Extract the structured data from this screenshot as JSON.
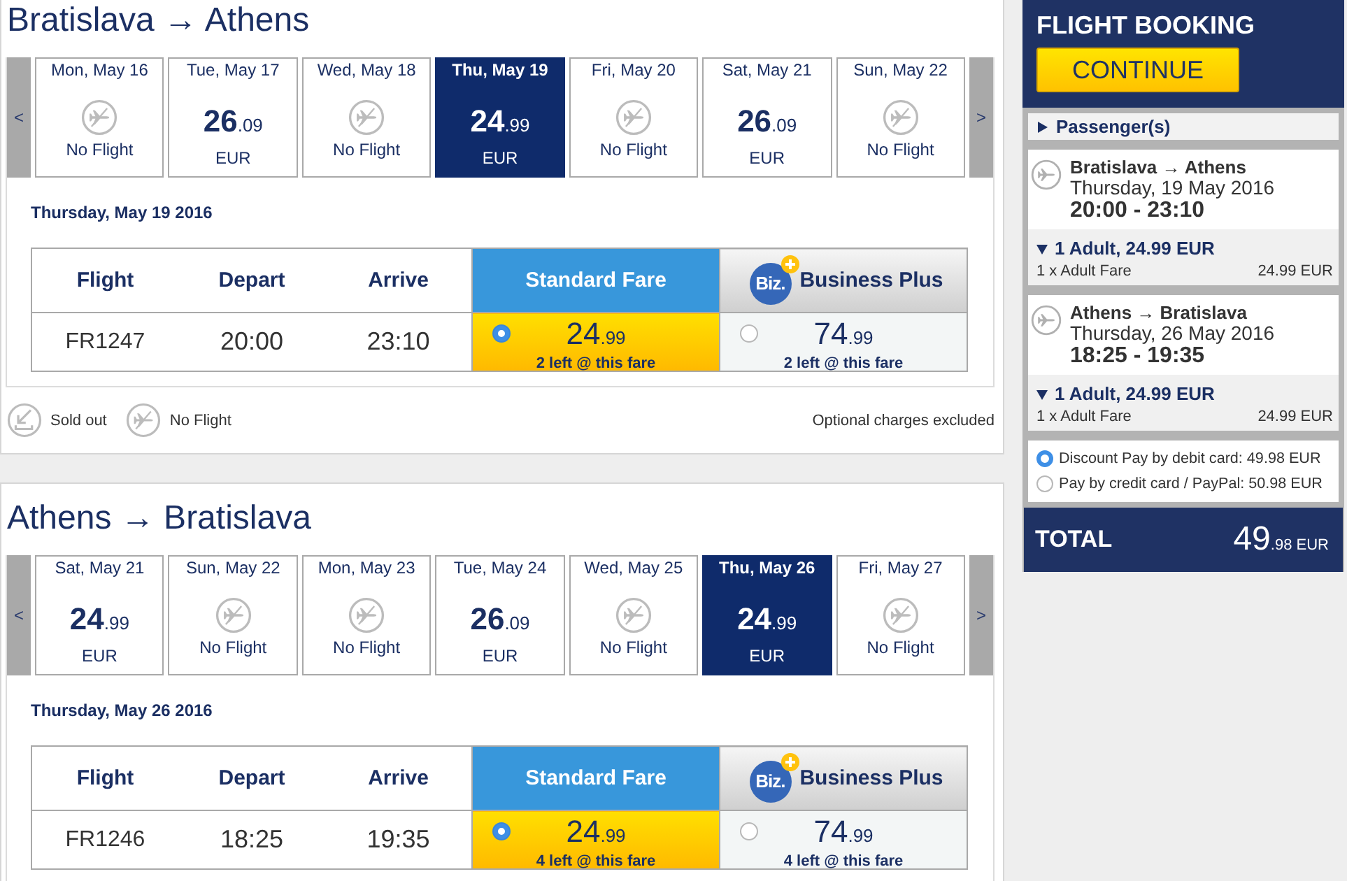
{
  "journeys": [
    {
      "title": "Bratislava → Athens",
      "prev_label": "<",
      "next_label": ">",
      "dates": [
        {
          "label": "Mon, May 16",
          "kind": "no_flight",
          "text": "No Flight",
          "selected": false
        },
        {
          "label": "Tue, May 17",
          "kind": "price",
          "price_whole": "26",
          "price_cents": ".09",
          "currency": "EUR",
          "selected": false
        },
        {
          "label": "Wed, May 18",
          "kind": "no_flight",
          "text": "No Flight",
          "selected": false
        },
        {
          "label": "Thu, May 19",
          "kind": "price",
          "price_whole": "24",
          "price_cents": ".99",
          "currency": "EUR",
          "selected": true
        },
        {
          "label": "Fri, May 20",
          "kind": "no_flight",
          "text": "No Flight",
          "selected": false
        },
        {
          "label": "Sat, May 21",
          "kind": "price",
          "price_whole": "26",
          "price_cents": ".09",
          "currency": "EUR",
          "selected": false
        },
        {
          "label": "Sun, May 22",
          "kind": "no_flight",
          "text": "No Flight",
          "selected": false
        }
      ],
      "date_heading": "Thursday, May 19 2016",
      "table": {
        "columns": [
          {
            "kind": "plain",
            "label": "Flight"
          },
          {
            "kind": "plain",
            "label": "Depart"
          },
          {
            "kind": "plain",
            "label": "Arrive"
          },
          {
            "kind": "standard",
            "label": "Standard Fare"
          },
          {
            "kind": "business",
            "badge": "Biz.",
            "label": "Business Plus"
          }
        ],
        "rows": [
          {
            "flight": "FR1247",
            "depart": "20:00",
            "arrive": "23:10",
            "fares": [
              {
                "price_whole": "24",
                "price_cents": ".99",
                "availability": "2 left @ this fare",
                "selected": true
              },
              {
                "price_whole": "74",
                "price_cents": ".99",
                "availability": "2 left @ this fare",
                "selected": false
              }
            ]
          }
        ]
      },
      "legend": [
        {
          "kind": "sold_out",
          "label": "Sold out"
        },
        {
          "kind": "no_flight",
          "label": "No Flight"
        }
      ],
      "note": "Optional charges excluded"
    },
    {
      "title": "Athens → Bratislava",
      "prev_label": "<",
      "next_label": ">",
      "dates": [
        {
          "label": "Sat, May 21",
          "kind": "price",
          "price_whole": "24",
          "price_cents": ".99",
          "currency": "EUR",
          "selected": false
        },
        {
          "label": "Sun, May 22",
          "kind": "no_flight",
          "text": "No Flight",
          "selected": false
        },
        {
          "label": "Mon, May 23",
          "kind": "no_flight",
          "text": "No Flight",
          "selected": false
        },
        {
          "label": "Tue, May 24",
          "kind": "price",
          "price_whole": "26",
          "price_cents": ".09",
          "currency": "EUR",
          "selected": false
        },
        {
          "label": "Wed, May 25",
          "kind": "no_flight",
          "text": "No Flight",
          "selected": false
        },
        {
          "label": "Thu, May 26",
          "kind": "price",
          "price_whole": "24",
          "price_cents": ".99",
          "currency": "EUR",
          "selected": true
        },
        {
          "label": "Fri, May 27",
          "kind": "no_flight",
          "text": "No Flight",
          "selected": false
        }
      ],
      "date_heading": "Thursday, May 26 2016",
      "table": {
        "columns": [
          {
            "kind": "plain",
            "label": "Flight"
          },
          {
            "kind": "plain",
            "label": "Depart"
          },
          {
            "kind": "plain",
            "label": "Arrive"
          },
          {
            "kind": "standard",
            "label": "Standard Fare"
          },
          {
            "kind": "business",
            "badge": "Biz.",
            "label": "Business Plus"
          }
        ],
        "rows": [
          {
            "flight": "FR1246",
            "depart": "18:25",
            "arrive": "19:35",
            "fares": [
              {
                "price_whole": "24",
                "price_cents": ".99",
                "availability": "4 left @ this fare",
                "selected": true
              },
              {
                "price_whole": "74",
                "price_cents": ".99",
                "availability": "4 left @ this fare",
                "selected": false
              }
            ]
          }
        ]
      }
    }
  ],
  "booking": {
    "title": "FLIGHT BOOKING",
    "continue_button": "CONTINUE",
    "passengers": {
      "label": "Passenger(s)",
      "expanded": false
    },
    "flights": [
      {
        "route": "Bratislava → Athens",
        "date": "Thursday, 19 May 2016",
        "times": "20:00 - 23:10",
        "fare_summary": "1 Adult, 24.99 EUR",
        "expanded": true,
        "lines": [
          {
            "label": "1 x Adult Fare",
            "amount": "24.99 EUR"
          }
        ]
      },
      {
        "route": "Athens → Bratislava",
        "date": "Thursday, 26 May 2016",
        "times": "18:25 - 19:35",
        "fare_summary": "1 Adult, 24.99 EUR",
        "expanded": true,
        "lines": [
          {
            "label": "1 x Adult Fare",
            "amount": "24.99 EUR"
          }
        ]
      }
    ],
    "payment_options": [
      {
        "label": "Discount Pay by debit card: 49.98 EUR",
        "selected": true
      },
      {
        "label": "Pay by credit card / PayPal: 50.98 EUR",
        "selected": false
      }
    ],
    "total": {
      "label": "TOTAL",
      "price_whole": "49",
      "price_cents": ".98",
      "currency": "EUR"
    }
  }
}
